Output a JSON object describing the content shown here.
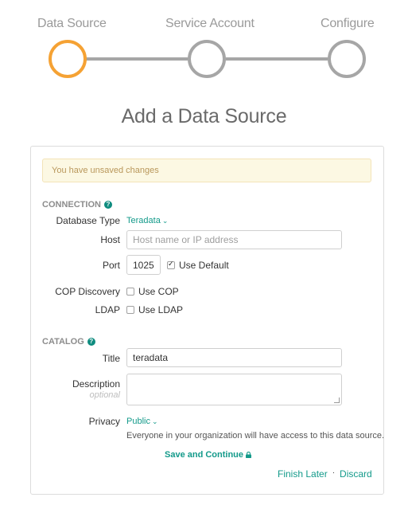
{
  "stepper": {
    "steps": [
      {
        "label": "Data Source",
        "state": "active"
      },
      {
        "label": "Service Account",
        "state": "inactive"
      },
      {
        "label": "Configure",
        "state": "inactive"
      }
    ],
    "active_color": "#f5a234",
    "inactive_color": "#a6a6a6"
  },
  "page_title": "Add a Data Source",
  "alert": {
    "text": "You have unsaved changes"
  },
  "connection": {
    "section_label": "CONNECTION",
    "help_icon": "question-circle-icon",
    "database_type_label": "Database Type",
    "database_type_value": "Teradata",
    "host_label": "Host",
    "host_placeholder": "Host name or IP address",
    "host_value": "",
    "port_label": "Port",
    "port_value": "1025",
    "use_default_label": "Use Default",
    "use_default_checked": true,
    "cop_label": "COP Discovery",
    "use_cop_label": "Use COP",
    "use_cop_checked": false,
    "ldap_label": "LDAP",
    "use_ldap_label": "Use LDAP",
    "use_ldap_checked": false
  },
  "catalog": {
    "section_label": "CATALOG",
    "help_icon": "question-circle-icon",
    "title_label": "Title",
    "title_value": "teradata",
    "description_label": "Description",
    "description_sublabel": "optional",
    "description_value": "",
    "privacy_label": "Privacy",
    "privacy_value": "Public",
    "privacy_note": "Everyone in your organization will have access to this data source."
  },
  "actions": {
    "save_label": "Save and Continue",
    "save_icon": "lock-icon",
    "finish_later_label": "Finish Later",
    "separator": "·",
    "discard_label": "Discard"
  },
  "colors": {
    "accent": "#139a8a",
    "alert_bg": "#fcf8e3",
    "alert_text": "#b9975b"
  }
}
